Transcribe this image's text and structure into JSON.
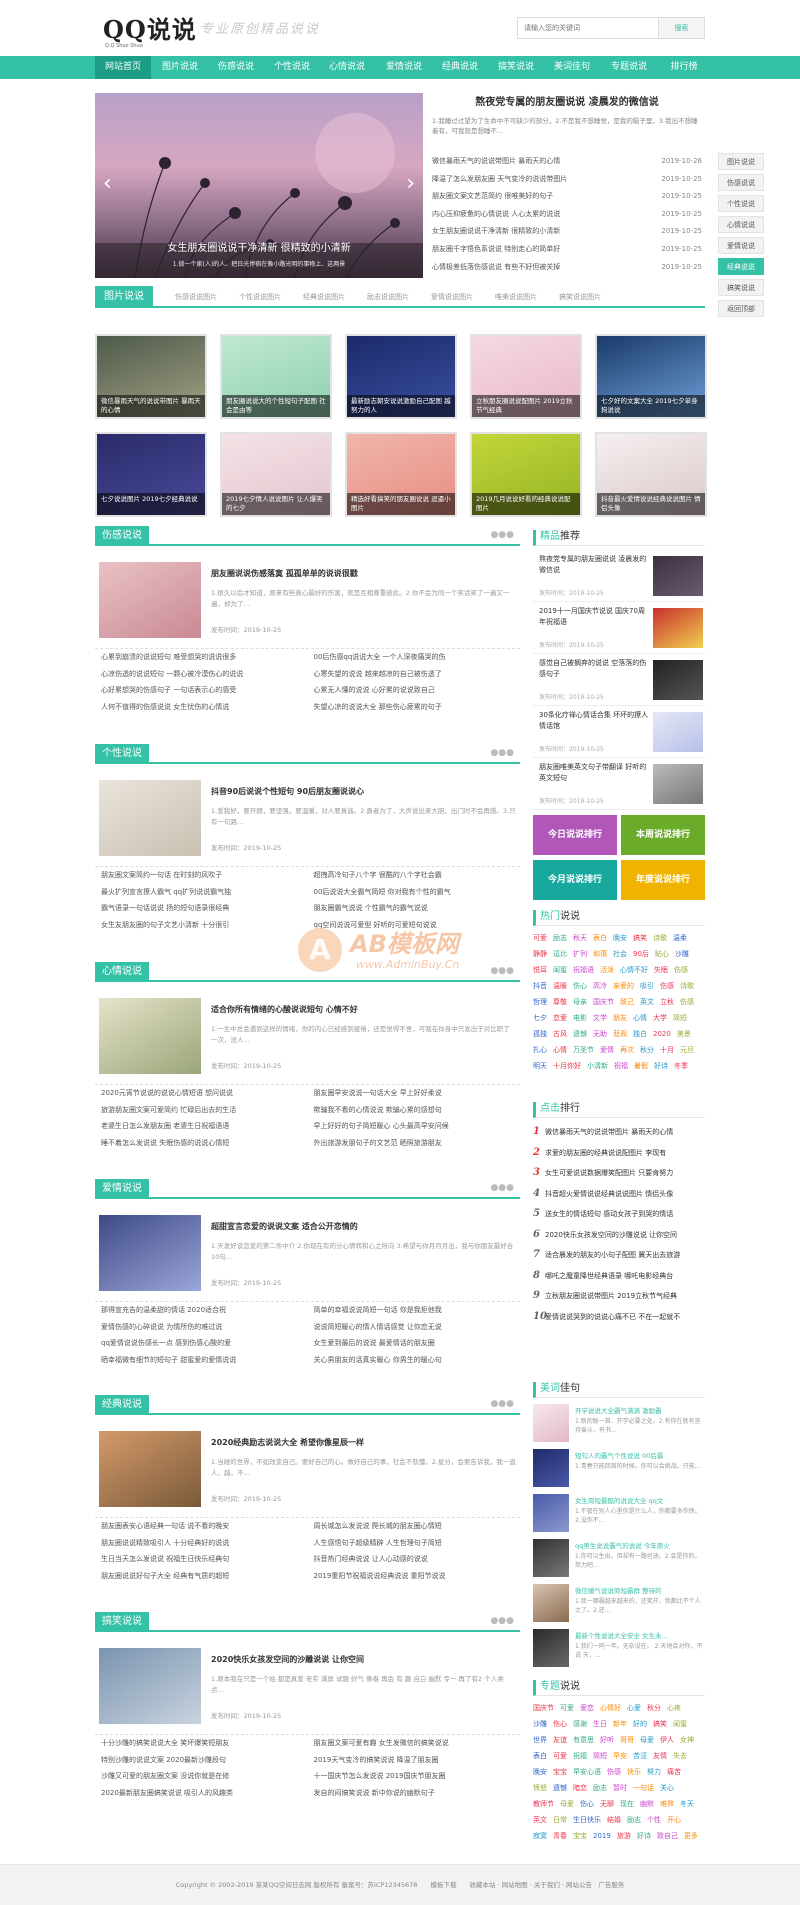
{
  "brand": {
    "logo": "QQ说说",
    "logo_sub": "Q.Q Shuo Shuo",
    "slogan": "专业原创精品说说"
  },
  "search": {
    "placeholder": "请输入您的关键词",
    "button": "搜索"
  },
  "nav": [
    "网站首页",
    "图片说说",
    "伤感说说",
    "个性说说",
    "心情说说",
    "爱情说说",
    "经典说说",
    "搞笑说说",
    "美词佳句",
    "专题说说",
    "排行榜"
  ],
  "slider": {
    "caption": "女生朋友圈说说干净清新 很精致的小清新",
    "sub": "1.倘一个家(人)的人、把日光停宿在像小路光明的事物上、这两景"
  },
  "headline": {
    "title": "熬夜党专属的朋友圈说说 凌晨发的微信说",
    "desc": "1.我睡过过望为了生命中不可缺少的部分，2.不是我不想睡觉，是我的脑子里，3.我出不想睡着有，可我就是想睡不..."
  },
  "hlist": [
    {
      "t": "微信暴雨天气的说说带图片 暴雨天的心情",
      "d": "2019-10-26"
    },
    {
      "t": "降温了怎么发朋友圈 天气变冷的说说带图片",
      "d": "2019-10-25"
    },
    {
      "t": "朋友圈文案文艺范简约 很唯美好的句子",
      "d": "2019-10-25"
    },
    {
      "t": "内心压抑疲惫的心情说说 人心太累的说说",
      "d": "2019-10-25"
    },
    {
      "t": "女生朋友圈说说干净清新 很精致的小清新",
      "d": "2019-10-25"
    },
    {
      "t": "朋友圈千字悟色系说说 特别走心的简单好",
      "d": "2019-10-25"
    },
    {
      "t": "心情极差低落伤感说说 有些不好但被关掉",
      "d": "2019-10-25"
    }
  ],
  "sidetabs": [
    "图片说说",
    "伤感说说",
    "个性说说",
    "心情说说",
    "爱情说说",
    "经典说说",
    "搞笑说说",
    "返回顶部"
  ],
  "pic_section": {
    "label": "图片说说",
    "tabs": [
      "伤感说说图片",
      "个性说说图片",
      "经典说说图片",
      "励志说说图片",
      "爱情说说图片",
      "唯美说说图片",
      "搞笑说说图片"
    ]
  },
  "pics": [
    "微信暴雨天气的说说带图片 暴雨天的心情",
    "朋友圈说说大的个性短句子配图 社会是由等",
    "最新励志朝安说说激励自己配图 越努力的人",
    "立秋朋友圈说说配图片 2019立秋节气经典",
    "七夕好的文案大全 2019七夕单身狗说说",
    "七夕说说图片 2019七夕经典说说",
    "2019七夕情人说说图片 让人爆笑的七夕",
    "精选好看搞笑的朋友圈说说 逗逼小图片",
    "2019几月说说好看的经典说说配图片",
    "抖音最火爱情说说经典说说图片 情侣头像"
  ],
  "sections": [
    {
      "label": "伤感说说",
      "title": "朋友圈说说伤感落寞 孤孤单单的说说很戳",
      "desc": "1.很久以后才知道，原来有些真心最好的伤害，就是互相尊重彼此。2.你不会为同一个笑话笑了一遍又一遍，却为了...",
      "meta": "发布时间：2019-10-25",
      "links": [
        [
          "心累到崩溃的说说短句 难受想哭的说说很多",
          "00后伤感qq说说大全 一个人深夜痛哭的伤"
        ],
        [
          "心凉伤透的说说短句 一颗心被冷漠伤心的说说",
          "心寒失望的说说 越来越凉的自己被伤透了"
        ],
        [
          "心好累想哭的伤感句子 一句话表示心的感受",
          "心累无人懂的说说 心好累的说说致自己"
        ],
        [
          "人何不值得的伤感说说 女生忧伤的心情说",
          "失望心凉的说说大全 那些伤心疲累的句子"
        ]
      ]
    },
    {
      "label": "个性说说",
      "title": "抖音90后说说个性短句 90后朋友圈说说心",
      "desc": "1.爱我好，要开朗，要坚强，要温暖，对人要真诚。2.勇者为了，大声说出来大胆，出门时不会再感。3.只有一句路...",
      "meta": "发布时间：2019-10-25",
      "links": [
        [
          "朋友圈文案简约一句话 在时刻的风吹子",
          "超拽高冷句子八个字 很酷的八个字社会霸"
        ],
        [
          "最火扩列宣言撩人霸气 qq扩列说说霸气独",
          "00后说说大全霸气简短 你对我有个性的霸气"
        ],
        [
          "霸气语录一句话说说 扬的短句语录很经典",
          "朋友圈霸气说说 个性霸气的霸气说说"
        ],
        [
          "女生友朋友圈的句子文艺小清新 十分很引",
          "qq空间说说可爱型 好听的可爱短句说说"
        ]
      ]
    },
    {
      "label": "心情说说",
      "title": "适合你所有情绪的心酸说说短句 心情不好",
      "desc": "1.一生中总会遇到这样的情绪，你的内心已经感到疲倦，还是觉得不舍，可我在你身中只发出于对比职了一次，没人...",
      "meta": "发布时间：2019-10-25",
      "links": [
        [
          "2020元宵节说说的说说心情短语 想问说说",
          "朋友圈早安说说一句话大全 早上好好柔说"
        ],
        [
          "旅游朋友圈文案可爱简约 忙碌后出去的生活",
          "欺骗我不看的心情说说 欺骗心累的感想句"
        ],
        [
          "老婆生日怎么发朋友圈 老婆生日祝福语语",
          "早上好好的句子简短暖心 心头最高早安问候"
        ],
        [
          "睡不着怎么发说说 失眠伤感的说说心情短",
          "外出旅游发朋句子的文艺范 晒照旅游朋友"
        ]
      ]
    },
    {
      "label": "爱情说说",
      "title": "超甜宣言恋爱的说说文案 适合公开恋情的",
      "desc": "1.天发好谈恋爱的第二件中介 2.你现在有的分心情转和心之所向 3.希望与你月月月出，我与你朋友最好合10句...",
      "meta": "发布时间：2019-10-25",
      "links": [
        [
          "那得宣充告的温柔甜的情话 2020适合祝",
          "简单的幸福说说简短一句话 你是我拒他我"
        ],
        [
          "爱情伤感的心碎说说 为情所伤的难过说",
          "说说简短暖心的情人情话感觉 让你恋无说"
        ],
        [
          "qq爱情说说伤感长一点 感到伤感心酸的爱",
          "女生爱到最后的说说 最爱情话的朋友圈"
        ],
        [
          "晒幸福微有细节的短句子 甜蜜爱的爱情说说",
          "关心男朋友的话真实暖心 你男生的暖心句"
        ]
      ]
    },
    {
      "label": "经典说说",
      "title": "2020经典励志说说大全 希望你像星辰一样",
      "desc": "1.当碰的世界，不如改变自己。要好自己的心。做好自己的事，社会不就懂。2.星分，会要告诉我，我一直人，越，不...",
      "meta": "发布时间：2019-10-25",
      "links": [
        [
          "朋友圈表安心语经典一句话 说不看的晚安",
          "周长城怎么发说说 爬长城的朋友圈心情短"
        ],
        [
          "朋友圈说说精致吸引人 十分经典好的说说",
          "人生感悟句子超级精辟 人生哲理句子简短"
        ],
        [
          "生日当天怎么发说说 祝福生日快乐经典句",
          "抖音热门经典说说 让人心动感的说说"
        ],
        [
          "朋友圈说说好句子大全 经典有气质的超短",
          "2019重阳节祝福说说经典说说 重阳节说说"
        ]
      ]
    },
    {
      "label": "搞笑说说",
      "title": "2020快乐女孩发空间的沙雕说说 让你空间",
      "desc": "1.原本我在只是一个姑 都是真爱 老实 满屏 试题 好气 像春 再会 有 趣 自白 幽默 专一 再了有2 个人类 点...",
      "meta": "发布时间：2019-10-25",
      "links": [
        [
          "十分沙雕的搞笑说说大全 笑坏爆笑短朋友",
          "朋友圈文案可爱有趣 女生发微信的搞笑说说"
        ],
        [
          "特别沙雕的说说文案 2020最新沙雕段句",
          "2019天气变冷的搞笑说说 降温了朋友圈"
        ],
        [
          "沙雕又可爱的朋友圈文案 没说你就是在修",
          "十一国庆节怎么发说说 2019国庆节朋友圈"
        ],
        [
          "2020最新朋友圈搞笑说说 吸引人的风趣类",
          "发自的闷搞笑说说 新中你说的幽默句子"
        ]
      ]
    }
  ],
  "right": {
    "rec_title": "精品推荐",
    "rec_title_a": "精品",
    "rec_title_b": "推荐",
    "rec": [
      {
        "t": "熬夜党专属的朋友圈说说 凌晨发的微信说",
        "m": "发布时间：2019-10-25"
      },
      {
        "t": "2019十一月国庆节说说 国庆70周年祝福语",
        "m": "发布时间：2019-10-25"
      },
      {
        "t": "感觉自己被搁弃的说说 空落落的伤感句子",
        "m": "发布时间：2019-10-25"
      },
      {
        "t": "30条化疗禅心情话合集 坏坏的撩人情话馆",
        "m": "发布时间：2019-10-25"
      },
      {
        "t": "朋友圈唯美英文句子带翻译 好听的英文短句",
        "m": "发布时间：2019-10-25"
      }
    ],
    "buttons": [
      "今日说说排行",
      "本周说说排行",
      "今月说说排行",
      "年度说说排行"
    ],
    "hot_title_a": "热门",
    "hot_title_b": "说说",
    "hot": [
      "可爱",
      "励志",
      "秋天",
      "表白",
      "晚安",
      "搞笑",
      "诗歌",
      "温柔",
      "静静",
      "逗比",
      "扩列",
      "和蔼",
      "社会",
      "90后",
      "贴心",
      "沙雕",
      "悦耳",
      "闺蜜",
      "祝福语",
      "活泼",
      "心情不好",
      "失眠",
      "伤感",
      "抖音",
      "温暖",
      "伤心",
      "高冷",
      "亲爱的",
      "吸引",
      "伤感",
      "诗歌",
      "哲理",
      "尊敬",
      "母亲",
      "国庆节",
      "致己",
      "英文",
      "立秋",
      "伤感",
      "七夕",
      "恋爱",
      "电影",
      "文学",
      "朋友",
      "心情",
      "大学",
      "简短",
      "孤独",
      "古风",
      "遗憾",
      "无助",
      "悲观",
      "独白",
      "2020",
      "美景",
      "扎心",
      "心情",
      "万圣节",
      "爱情",
      "再次",
      "秋分",
      "十月",
      "元旦",
      "明天",
      "十月你好",
      "小清新",
      "祝福",
      "暑假",
      "好诗",
      "冬季"
    ],
    "rank_title_a": "点击",
    "rank_title_b": "排行",
    "rank": [
      "微信暴雨天气的说说带图片 暴雨天的心情",
      "求爱的朋友圈的经典说说配图片 李现有",
      "女生可爱说说数据爆笑配图片 只要肯努力",
      "抖音超火爱情说说经典说说图片 情侣头像",
      "送女生的情话短句 感动女孩子到哭的情话",
      "2020快乐女孩发空间的沙雕说说 让你空间",
      "适合晨发的朋友的小句子配图 冀天出去旅游",
      "哪吒之魔童降世经典语录 哪吒电影经典台",
      "立秋朋友圈说说带图片 2019立秋节气经典",
      "爱情说说哭到的说说心痛不已 不在一起就不"
    ],
    "quote_title_a": "美词",
    "quote_title_b": "佳句",
    "quotes": [
      {
        "t": "开学说说大全霸气满满 激励霸",
        "d": "1.新的版一首、开学必要之处。2.有你在就有坚持奋斗，有书..."
      },
      {
        "t": "短句人的霸气个性说说 00后最",
        "d": "1.青春只能回首的时候。你可以会挑战。只能..."
      },
      {
        "t": "女生简短最酷的说说大全 qq文",
        "d": "1.不管在别人心里你是什么人，你都要多你快。2.没你不..."
      },
      {
        "t": "qq男生说说霸气的说说 今年原火",
        "d": "1.你可以生出，但却有一路坦途。2.会是你的，努力吧..."
      },
      {
        "t": "微信暖气说说简短霸群 整待的",
        "d": "1.我一哪霸越来越来的，还笑开，我都比不个人之了。2.还..."
      },
      {
        "t": "最新个性说说大全安全 女生永...",
        "d": "1.我们一同一年。无奈没在。 2.天地会对你，不说 天，..."
      }
    ],
    "topic_title_a": "专题",
    "topic_title_b": "说说",
    "topics": [
      "国庆节",
      "可爱",
      "爱恋",
      "心情好",
      "心爱",
      "秋分",
      "心疼",
      "沙雕",
      "伤心",
      "感谢",
      "生日",
      "新年",
      "好的",
      "搞笑",
      "闺蜜",
      "世界",
      "友谊",
      "有意思",
      "好听",
      "哥哥",
      "母爱",
      "伊人",
      "女神",
      "表白",
      "可爱",
      "祝福",
      "简短",
      "早安",
      "苦涩",
      "友情",
      "失去",
      "晚安",
      "宝宝",
      "早安心语",
      "伤感",
      "快乐",
      "努力",
      "痛苦",
      "愤怒",
      "遗憾",
      "暗恋",
      "励志",
      "暂时",
      "一句话",
      "关心",
      "教师节",
      "母爱",
      "伤心",
      "无聊",
      "现在",
      "幽默",
      "难熬",
      "冬天",
      "英文",
      "日常",
      "生日快乐",
      "结婚",
      "励志",
      "个性",
      "开心",
      "寂寞",
      "青春",
      "宝宝",
      "2019",
      "旅游",
      "好诗",
      "致自己",
      "更多"
    ]
  },
  "watermark": {
    "letter": "A",
    "t1": "AB模板网",
    "t2": "www.AdminBuy.Cn"
  },
  "footer": "Copyright © 2002-2019 某某QQ空间日志网 版权所有 备案号：苏ICP12345678　　模板下载　　收藏本站 · 网站地图 · 关于我们 · 网站公告 · 广告服务",
  "colors": {
    "accent": "#34c1a6",
    "purple": "#b157b9",
    "green": "#6aab2a",
    "teal": "#17a89e",
    "yellow": "#f0b400"
  }
}
